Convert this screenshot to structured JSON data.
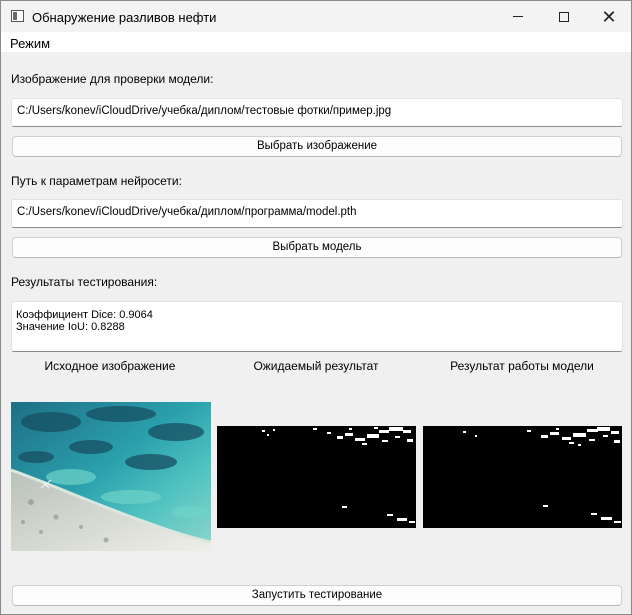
{
  "window": {
    "title": "Обнаружение разливов нефти",
    "icon": "app-window-icon",
    "controls": [
      "minimize-icon",
      "maximize-icon",
      "close-icon"
    ]
  },
  "menubar": {
    "items": [
      {
        "label": "Режим"
      }
    ]
  },
  "image_section": {
    "label": "Изображение для проверки модели:",
    "path": "C:/Users/konev/iCloudDrive/учебка/диплом/тестовые фотки/пример.jpg",
    "button": "Выбрать изображение"
  },
  "model_section": {
    "label": "Путь к параметрам нейросети:",
    "path": "C:/Users/konev/iCloudDrive/учебка/диплом/программа/model.pth",
    "button": "Выбрать модель"
  },
  "results_section": {
    "label": "Результаты тестирования:",
    "dice_line": "Коэффициент Dice: 0.9064",
    "iou_line": "Значение IoU: 0.8288"
  },
  "previews": {
    "source_caption": "Исходное изображение",
    "expected_caption": "Ожидаемый результат",
    "model_caption": "Результат работы модели"
  },
  "run_button": "Запустить тестирование"
}
